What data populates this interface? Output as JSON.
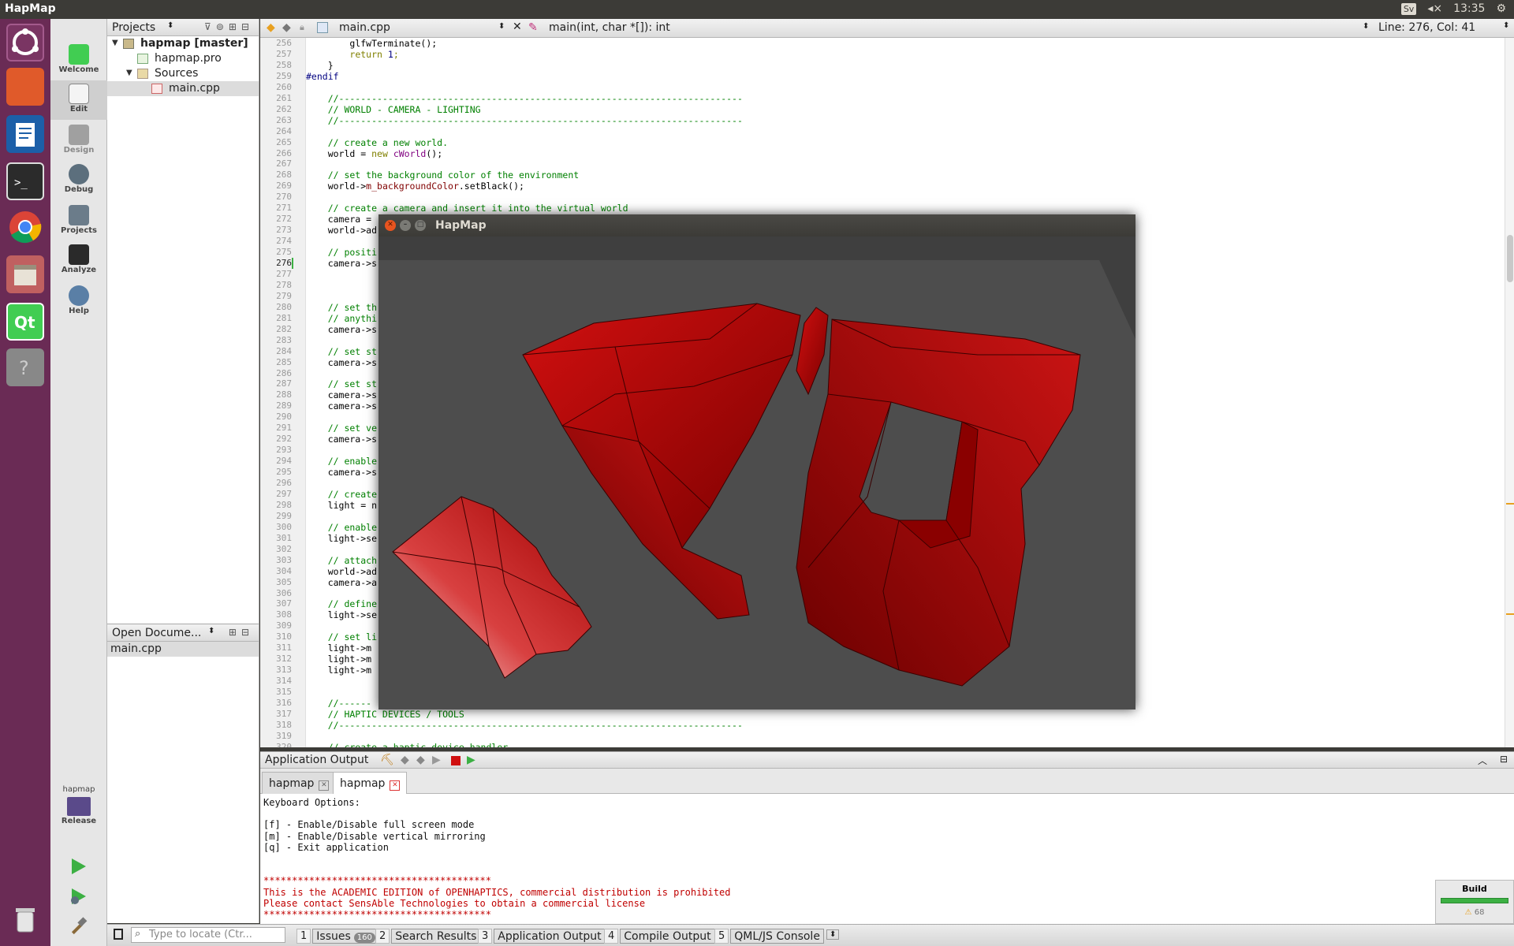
{
  "topbar": {
    "app_title": "HapMap",
    "keyboard_layout": "Sv",
    "time": "13:35"
  },
  "launcher": {
    "items": [
      "ubuntu-dash-icon",
      "files-icon",
      "writer-icon",
      "terminal-icon",
      "chrome-icon",
      "archive-icon",
      "qt-creator-icon",
      "unknown-app-icon",
      "trash-icon"
    ]
  },
  "modebar": {
    "modes": [
      "Welcome",
      "Edit",
      "Design",
      "Debug",
      "Projects",
      "Analyze",
      "Help"
    ],
    "active": "Edit",
    "target_project": "hapmap",
    "target_config": "Release"
  },
  "projects_pane": {
    "title": "Projects",
    "tree": {
      "root": "hapmap [master]",
      "pro_file": "hapmap.pro",
      "sources": "Sources",
      "main": "main.cpp"
    }
  },
  "open_documents": {
    "title": "Open Docume...",
    "files": [
      "main.cpp"
    ]
  },
  "editor_toolbar": {
    "file": "main.cpp",
    "symbol": "main(int, char *[]): int",
    "position": "Line: 276, Col: 41"
  },
  "editor": {
    "current_line": "276",
    "lines": [
      {
        "n": "256",
        "code": "        glfwTerminate();",
        "cls": ""
      },
      {
        "n": "257",
        "code": "        return 1;",
        "cls": "kw"
      },
      {
        "n": "258",
        "code": "    }",
        "cls": ""
      },
      {
        "n": "259",
        "code": "#endif",
        "cls": "pp"
      },
      {
        "n": "260",
        "code": "",
        "cls": ""
      },
      {
        "n": "261",
        "code": "    //--------------------------------------------------------------------------",
        "cls": "com"
      },
      {
        "n": "262",
        "code": "    // WORLD - CAMERA - LIGHTING",
        "cls": "com"
      },
      {
        "n": "263",
        "code": "    //--------------------------------------------------------------------------",
        "cls": "com"
      },
      {
        "n": "264",
        "code": "",
        "cls": ""
      },
      {
        "n": "265",
        "code": "    // create a new world.",
        "cls": "com"
      },
      {
        "n": "266",
        "code": "    world = new cWorld();",
        "cls": ""
      },
      {
        "n": "267",
        "code": "",
        "cls": ""
      },
      {
        "n": "268",
        "code": "    // set the background color of the environment",
        "cls": "com"
      },
      {
        "n": "269",
        "code": "    world->m_backgroundColor.setBlack();",
        "cls": ""
      },
      {
        "n": "270",
        "code": "",
        "cls": ""
      },
      {
        "n": "271",
        "code": "    // create a camera and insert it into the virtual world",
        "cls": "com"
      },
      {
        "n": "272",
        "code": "    camera = ",
        "cls": ""
      },
      {
        "n": "273",
        "code": "    world->ad",
        "cls": ""
      },
      {
        "n": "274",
        "code": "",
        "cls": ""
      },
      {
        "n": "275",
        "code": "    // positi",
        "cls": "com"
      },
      {
        "n": "276",
        "code": "    camera->s",
        "cls": ""
      },
      {
        "n": "277",
        "code": "",
        "cls": ""
      },
      {
        "n": "278",
        "code": "",
        "cls": ""
      },
      {
        "n": "279",
        "code": "",
        "cls": ""
      },
      {
        "n": "280",
        "code": "    // set th",
        "cls": "com"
      },
      {
        "n": "281",
        "code": "    // anythi",
        "cls": "com"
      },
      {
        "n": "282",
        "code": "    camera->s",
        "cls": ""
      },
      {
        "n": "283",
        "code": "",
        "cls": ""
      },
      {
        "n": "284",
        "code": "    // set st",
        "cls": "com"
      },
      {
        "n": "285",
        "code": "    camera->s",
        "cls": ""
      },
      {
        "n": "286",
        "code": "",
        "cls": ""
      },
      {
        "n": "287",
        "code": "    // set st",
        "cls": "com"
      },
      {
        "n": "288",
        "code": "    camera->s",
        "cls": ""
      },
      {
        "n": "289",
        "code": "    camera->s",
        "cls": ""
      },
      {
        "n": "290",
        "code": "",
        "cls": ""
      },
      {
        "n": "291",
        "code": "    // set ve",
        "cls": "com"
      },
      {
        "n": "292",
        "code": "    camera->s",
        "cls": ""
      },
      {
        "n": "293",
        "code": "",
        "cls": ""
      },
      {
        "n": "294",
        "code": "    // enable",
        "cls": "com"
      },
      {
        "n": "295",
        "code": "    camera->s",
        "cls": ""
      },
      {
        "n": "296",
        "code": "",
        "cls": ""
      },
      {
        "n": "297",
        "code": "    // create",
        "cls": "com"
      },
      {
        "n": "298",
        "code": "    light = n",
        "cls": ""
      },
      {
        "n": "299",
        "code": "",
        "cls": ""
      },
      {
        "n": "300",
        "code": "    // enable",
        "cls": "com"
      },
      {
        "n": "301",
        "code": "    light->se",
        "cls": ""
      },
      {
        "n": "302",
        "code": "",
        "cls": ""
      },
      {
        "n": "303",
        "code": "    // attach",
        "cls": "com"
      },
      {
        "n": "304",
        "code": "    world->ad",
        "cls": ""
      },
      {
        "n": "305",
        "code": "    camera->a",
        "cls": ""
      },
      {
        "n": "306",
        "code": "",
        "cls": ""
      },
      {
        "n": "307",
        "code": "    // define",
        "cls": "com"
      },
      {
        "n": "308",
        "code": "    light->se",
        "cls": ""
      },
      {
        "n": "309",
        "code": "",
        "cls": ""
      },
      {
        "n": "310",
        "code": "    // set li",
        "cls": "com"
      },
      {
        "n": "311",
        "code": "    light->m",
        "cls": ""
      },
      {
        "n": "312",
        "code": "    light->m",
        "cls": ""
      },
      {
        "n": "313",
        "code": "    light->m",
        "cls": ""
      },
      {
        "n": "314",
        "code": "",
        "cls": ""
      },
      {
        "n": "315",
        "code": "",
        "cls": ""
      },
      {
        "n": "316",
        "code": "    //------",
        "cls": "com"
      },
      {
        "n": "317",
        "code": "    // HAPTIC DEVICES / TOOLS",
        "cls": "com"
      },
      {
        "n": "318",
        "code": "    //--------------------------------------------------------------------------",
        "cls": "com"
      },
      {
        "n": "319",
        "code": "",
        "cls": ""
      },
      {
        "n": "320",
        "code": "    // create a haptic device handler",
        "cls": "com"
      }
    ]
  },
  "hapmap_window": {
    "title": "HapMap"
  },
  "output_pane": {
    "title": "Application Output",
    "tabs": [
      "hapmap",
      "hapmap"
    ],
    "lines": [
      {
        "text": "Keyboard Options:",
        "red": false
      },
      {
        "text": "",
        "red": false
      },
      {
        "text": "[f] - Enable/Disable full screen mode",
        "red": false
      },
      {
        "text": "[m] - Enable/Disable vertical mirroring",
        "red": false
      },
      {
        "text": "[q] - Exit application",
        "red": false
      },
      {
        "text": "",
        "red": false
      },
      {
        "text": "",
        "red": false
      },
      {
        "text": "****************************************",
        "red": true
      },
      {
        "text": "This is the ACADEMIC EDITION of OPENHAPTICS, commercial distribution is prohibited",
        "red": true
      },
      {
        "text": "Please contact SensAble Technologies to obtain a commercial license",
        "red": true
      },
      {
        "text": "****************************************",
        "red": true
      }
    ],
    "build_label": "Build",
    "warning_count": "68"
  },
  "statusbar": {
    "locator_placeholder": "Type to locate (Ctr...",
    "panes": [
      {
        "num": "1",
        "label": "Issues",
        "badge": "160"
      },
      {
        "num": "2",
        "label": "Search Results",
        "badge": ""
      },
      {
        "num": "3",
        "label": "Application Output",
        "badge": ""
      },
      {
        "num": "4",
        "label": "Compile Output",
        "badge": ""
      },
      {
        "num": "5",
        "label": "QML/JS Console",
        "badge": ""
      }
    ]
  },
  "colors": {
    "launcher_bg": "#6a2b55",
    "model_red": "#b30000",
    "viewport_bg": "#4d4d4d"
  }
}
